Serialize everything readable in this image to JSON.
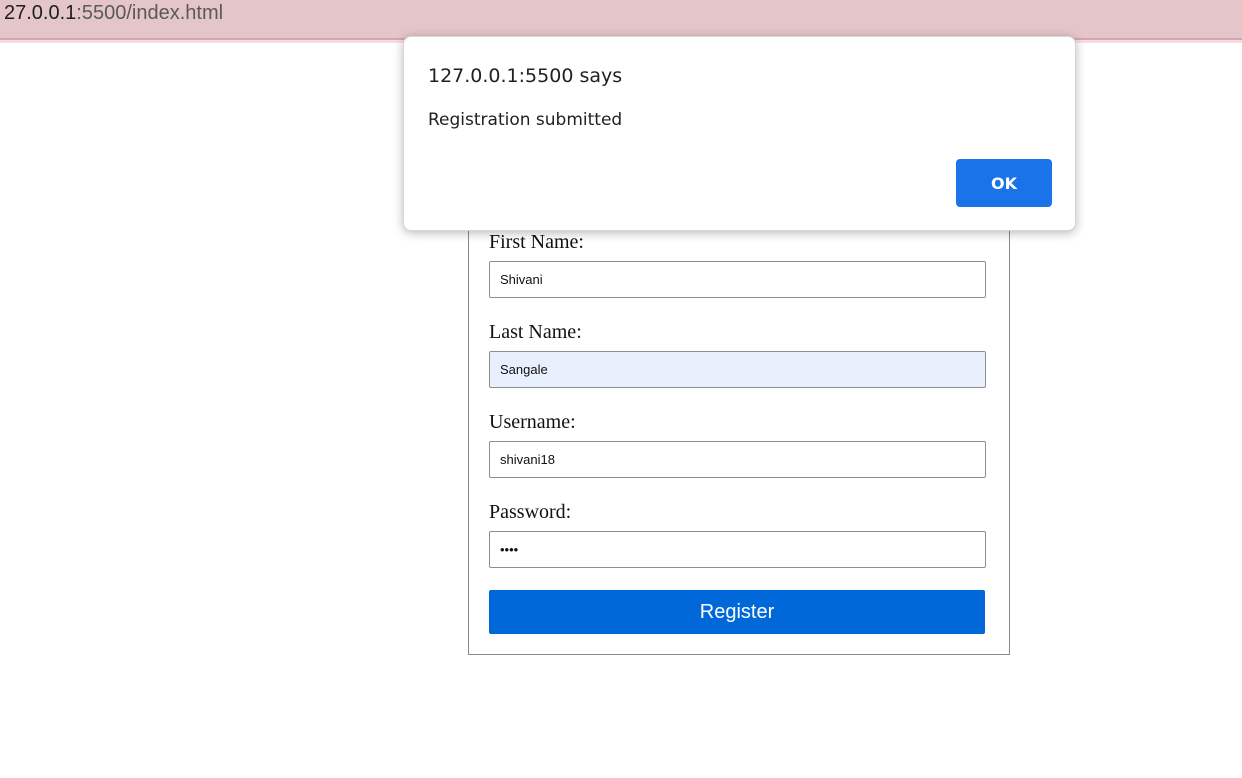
{
  "browser": {
    "address_host": "27.0.0.1",
    "address_path": ":5500/index.html"
  },
  "form": {
    "fields": [
      {
        "label": "First Name:",
        "value": "Shivani"
      },
      {
        "label": "Last Name:",
        "value": "Sangale"
      },
      {
        "label": "Username:",
        "value": "shivani18"
      },
      {
        "label": "Password:",
        "value": "••••"
      }
    ],
    "submit_label": "Register"
  },
  "dialog": {
    "title": "127.0.0.1:5500 says",
    "message": "Registration submitted",
    "ok_label": "OK"
  },
  "colors": {
    "address_bar": "#e4c5ca",
    "primary_button": "#0068d9",
    "dialog_button": "#1a73e8",
    "autofill_bg": "#e8f0fe"
  }
}
